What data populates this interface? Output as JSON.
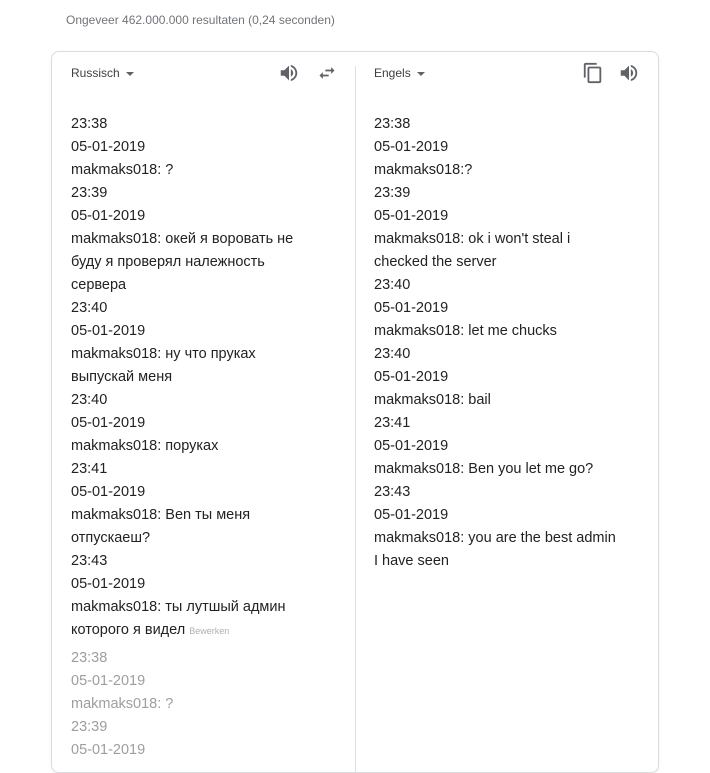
{
  "result_stats": "Ongeveer 462.000.000 resultaten (0,24 seconden)",
  "source": {
    "language": "Russisch",
    "lines": [
      "23:38",
      "05-01-2019",
      "makmaks018: ?",
      "23:39",
      "05-01-2019",
      "makmaks018: окей я воровать не",
      "буду я проверял належность",
      "сервера",
      "23:40",
      "05-01-2019",
      "makmaks018: ну что пруках",
      "выпускай меня",
      "23:40",
      "05-01-2019",
      "makmaks018: поруках",
      "23:41",
      "05-01-2019",
      "makmaks018: Ben ты меня",
      "отпускаеш?",
      "23:43",
      "05-01-2019",
      "makmaks018: ты лутшый админ"
    ],
    "last_line": "которого я видел",
    "edit_label": "Bewerken",
    "romanization_lines": [
      "23:38",
      "05-01-2019",
      "makmaks018: ?",
      "23:39",
      "05-01-2019"
    ]
  },
  "target": {
    "language": "Engels",
    "lines": [
      "23:38",
      "05-01-2019",
      "makmaks018:?",
      "23:39",
      "05-01-2019",
      "makmaks018: ok i won't steal i",
      "checked the server",
      "23:40",
      "05-01-2019",
      "makmaks018: let me chucks",
      "23:40",
      "05-01-2019",
      "makmaks018: bail",
      "23:41",
      "05-01-2019",
      "makmaks018: Ben you let me go?",
      "23:43",
      "05-01-2019",
      "makmaks018: you are the best admin",
      "I have seen"
    ]
  },
  "icons": {
    "source_speaker": "speaker-icon",
    "swap": "swap-languages-icon",
    "copy": "copy-icon",
    "target_speaker": "speaker-icon"
  }
}
